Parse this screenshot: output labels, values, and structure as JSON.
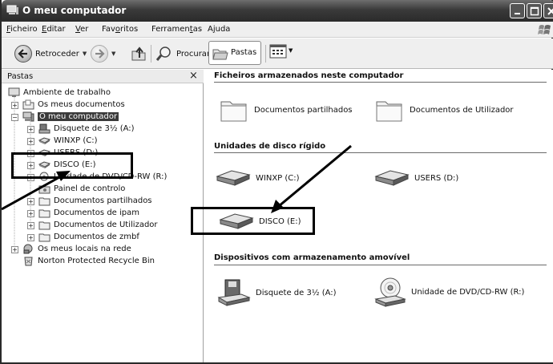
{
  "window": {
    "title": "O meu computador"
  },
  "menu": [
    {
      "label_pre": "",
      "label_u": "F",
      "label_post": "icheiro"
    },
    {
      "label_pre": "",
      "label_u": "E",
      "label_post": "ditar"
    },
    {
      "label_pre": "",
      "label_u": "V",
      "label_post": "er"
    },
    {
      "label_pre": "Fav",
      "label_u": "o",
      "label_post": "ritos"
    },
    {
      "label_pre": "Ferramen",
      "label_u": "t",
      "label_post": "as"
    },
    {
      "label_pre": "A",
      "label_u": "j",
      "label_post": "uda"
    }
  ],
  "toolbar": {
    "back_label": "Retroceder",
    "search_label": "Procurar",
    "folders_label": "Pastas"
  },
  "leftpane": {
    "title": "Pastas",
    "close_glyph": "×",
    "tree": [
      {
        "label": "Ambiente de trabalho"
      },
      {
        "label": "Os meus documentos"
      },
      {
        "label": "O meu computador"
      },
      {
        "label": "Disquete de 3½ (A:)"
      },
      {
        "label": "WINXP (C:)"
      },
      {
        "label": "USERS (D:)"
      },
      {
        "label": "DISCO (E:)"
      },
      {
        "label": "Unidade de DVD/CD-RW (R:)"
      },
      {
        "label": "Painel de controlo"
      },
      {
        "label": "Documentos partilhados"
      },
      {
        "label": "Documentos de ipam"
      },
      {
        "label": "Documentos de Utilizador"
      },
      {
        "label": "Documentos de zmbf"
      },
      {
        "label": "Os meus locais na rede"
      },
      {
        "label": "Norton Protected Recycle Bin"
      }
    ]
  },
  "rightpane": {
    "groups": [
      {
        "title": "Ficheiros armazenados neste computador"
      },
      {
        "title": "Unidades de disco rígido"
      },
      {
        "title": "Dispositivos com armazenamento amovível"
      }
    ],
    "items": [
      {
        "label": "Documentos partilhados",
        "icon": "folder-icon"
      },
      {
        "label": "Documentos de Utilizador",
        "icon": "folder-icon"
      },
      {
        "label": "WINXP (C:)",
        "icon": "hard-drive-icon"
      },
      {
        "label": "USERS (D:)",
        "icon": "hard-drive-icon"
      },
      {
        "label": "DISCO (E:)",
        "icon": "hard-drive-icon"
      },
      {
        "label": "Disquete de 3½ (A:)",
        "icon": "floppy-drive-icon"
      },
      {
        "label": "Unidade de DVD/CD-RW (R:)",
        "icon": "dvd-drive-icon"
      }
    ]
  }
}
